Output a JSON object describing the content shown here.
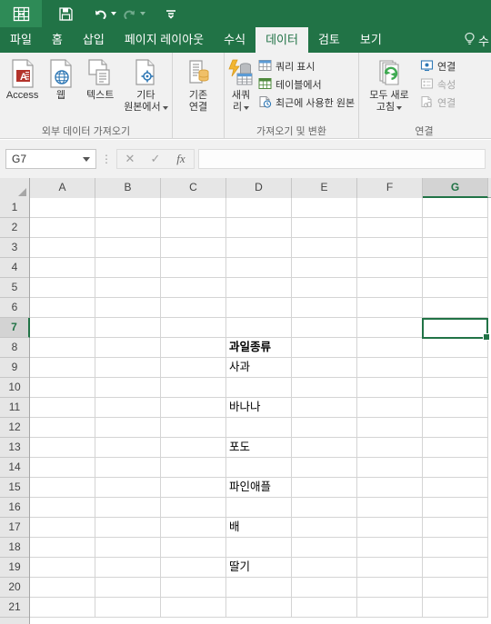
{
  "titlebar": {
    "icons": [
      {
        "name": "excel-logo-icon",
        "label": "Excel"
      },
      {
        "name": "save-icon",
        "label": "저장"
      },
      {
        "name": "undo-icon",
        "label": "실행 취소"
      },
      {
        "name": "redo-icon",
        "label": "다시 실행"
      },
      {
        "name": "customize-quick-access-toolbar-icon",
        "label": "빠른 실행 도구 모음 사용자 지정"
      }
    ]
  },
  "tabs": [
    {
      "id": "file",
      "label": "파일",
      "active": false
    },
    {
      "id": "home",
      "label": "홈",
      "active": false
    },
    {
      "id": "insert",
      "label": "삽입",
      "active": false
    },
    {
      "id": "page-layout",
      "label": "페이지 레이아웃",
      "active": false
    },
    {
      "id": "formulas",
      "label": "수식",
      "active": false
    },
    {
      "id": "data",
      "label": "데이터",
      "active": true
    },
    {
      "id": "review",
      "label": "검토",
      "active": false
    },
    {
      "id": "view",
      "label": "보기",
      "active": false
    }
  ],
  "tellme": {
    "label": "수"
  },
  "ribbon": {
    "groups": [
      {
        "id": "get-external-data",
        "label": "외부 데이터 가져오기",
        "big_buttons": [
          {
            "id": "access",
            "icon": "access-database-icon",
            "line1": "Access",
            "line2": ""
          },
          {
            "id": "web",
            "icon": "web-globe-icon",
            "line1": "웹",
            "line2": ""
          },
          {
            "id": "text",
            "icon": "text-file-icon",
            "line1": "텍스트",
            "line2": ""
          },
          {
            "id": "other-sources",
            "icon": "other-sources-icon",
            "line1": "기타",
            "line2": "원본에서",
            "has_caret": true
          }
        ]
      },
      {
        "id": "existing-connections",
        "label": "",
        "big_buttons": [
          {
            "id": "existing-connection",
            "icon": "existing-connections-icon",
            "line1": "기존",
            "line2": "연결"
          }
        ]
      },
      {
        "id": "get-and-transform",
        "label": "가져오기 및 변환",
        "big_buttons": [
          {
            "id": "new-query",
            "icon": "new-query-icon",
            "line1": "새쿼",
            "line2": "리",
            "has_caret": true
          }
        ],
        "small_buttons": [
          {
            "id": "show-queries",
            "icon": "show-queries-icon",
            "label": "쿼리 표시",
            "disabled": false
          },
          {
            "id": "from-table",
            "icon": "from-table-icon",
            "label": "테이블에서",
            "disabled": false
          },
          {
            "id": "recent-sources",
            "icon": "recent-sources-icon",
            "label": "최근에 사용한 원본",
            "disabled": false
          }
        ]
      },
      {
        "id": "connections",
        "label": "연결",
        "big_buttons": [
          {
            "id": "refresh-all",
            "icon": "refresh-all-icon",
            "line1": "모두 새로",
            "line2": "고침",
            "has_caret": true
          }
        ],
        "small_buttons": [
          {
            "id": "connections",
            "icon": "connections-icon",
            "label": "연결",
            "disabled": false
          },
          {
            "id": "properties",
            "icon": "properties-icon",
            "label": "속성",
            "disabled": true
          },
          {
            "id": "edit-links",
            "icon": "edit-links-icon",
            "label": "연결",
            "disabled": true
          }
        ]
      }
    ]
  },
  "formula_bar": {
    "name_box_value": "G7",
    "cancel_label": "✕",
    "enter_label": "✓",
    "fx_label": "fx",
    "formula_value": "",
    "formula_placeholder": ""
  },
  "grid": {
    "columns": [
      "A",
      "B",
      "C",
      "D",
      "E",
      "F",
      "G"
    ],
    "selected_column": "G",
    "rows": [
      1,
      2,
      3,
      4,
      5,
      6,
      7,
      8,
      9,
      10,
      11,
      12,
      13,
      14,
      15,
      16,
      17,
      18,
      19,
      20,
      21
    ],
    "selected_row": 7,
    "active_cell": "G7",
    "cell_values": [
      {
        "row": 8,
        "col": "D",
        "value": "과일종류",
        "bold": true
      },
      {
        "row": 9,
        "col": "D",
        "value": "사과",
        "bold": false
      },
      {
        "row": 11,
        "col": "D",
        "value": "바나나",
        "bold": false
      },
      {
        "row": 13,
        "col": "D",
        "value": "포도",
        "bold": false
      },
      {
        "row": 15,
        "col": "D",
        "value": "파인애플",
        "bold": false
      },
      {
        "row": 17,
        "col": "D",
        "value": "배",
        "bold": false
      },
      {
        "row": 19,
        "col": "D",
        "value": "딸기",
        "bold": false
      }
    ]
  },
  "colors": {
    "excel_green": "#217346",
    "ribbon_bg": "#f1f1f1",
    "header_bg": "#e6e6e6",
    "gridline": "#d4d4d4",
    "selection": "#217346"
  }
}
